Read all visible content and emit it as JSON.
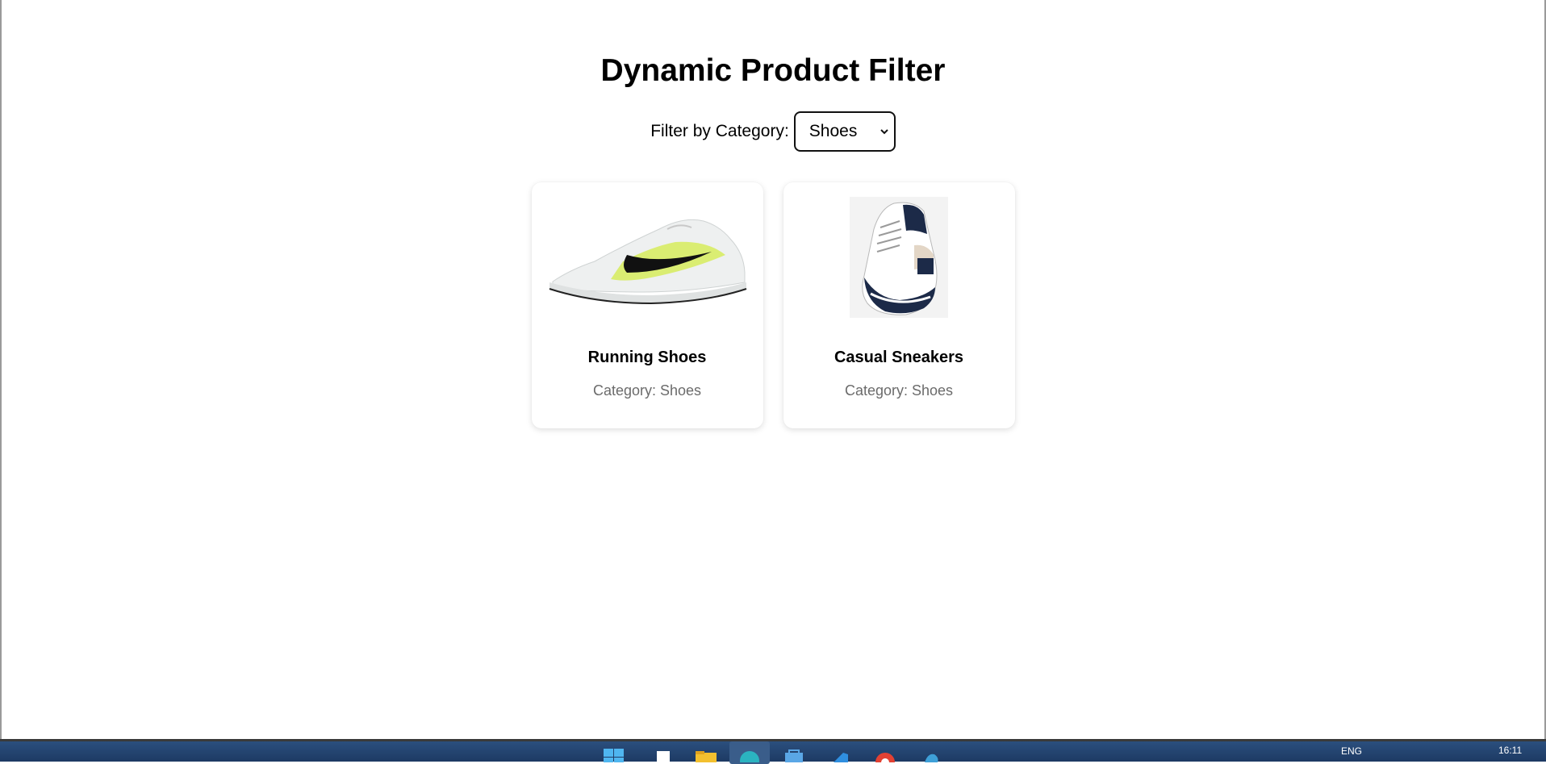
{
  "page": {
    "title": "Dynamic Product Filter"
  },
  "filter": {
    "label": "Filter by Category:",
    "selected": "Shoes"
  },
  "products": [
    {
      "name": "Running Shoes",
      "category_text": "Category: Shoes",
      "image_icon": "running-shoe-image"
    },
    {
      "name": "Casual Sneakers",
      "category_text": "Category: Shoes",
      "image_icon": "casual-sneaker-image"
    }
  ],
  "taskbar": {
    "language": "ENG",
    "time": "16:11",
    "icons": [
      "windows-start-icon",
      "notepad-icon",
      "file-explorer-icon",
      "edge-browser-icon",
      "store-icon",
      "vscode-icon",
      "chrome-icon",
      "app-icon"
    ]
  },
  "colors": {
    "taskbar": "#1d3a63",
    "category_text": "#6b6b6b",
    "accent_green": "#d4ec5a"
  }
}
